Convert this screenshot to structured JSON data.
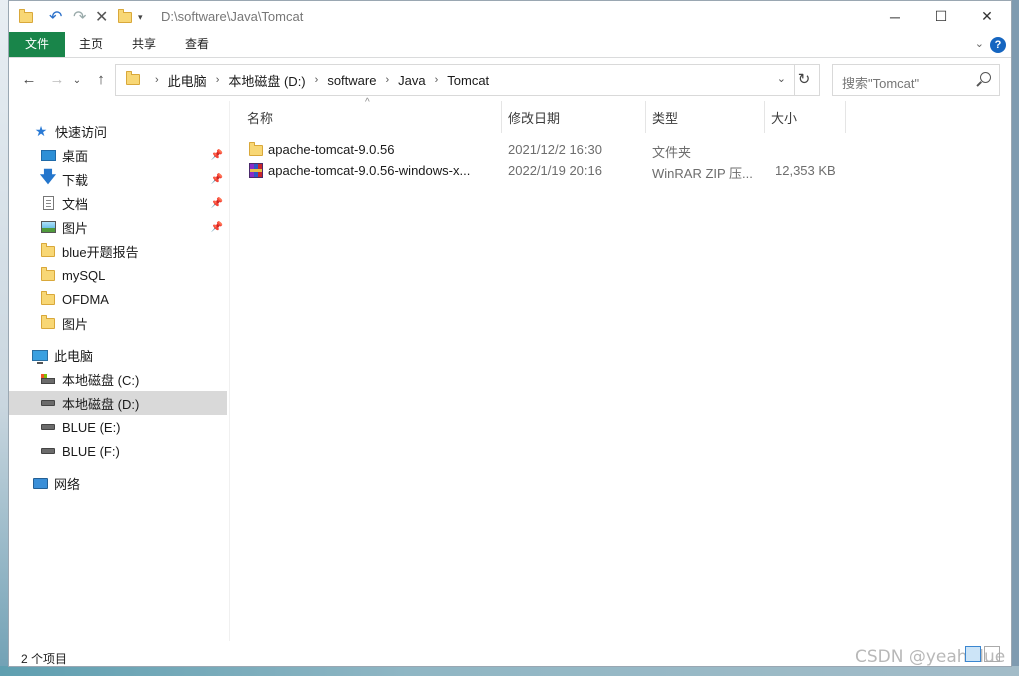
{
  "title_bar": {
    "path": "D:\\software\\Java\\Tomcat",
    "controls": {
      "minimize": "─",
      "maximize": "☐",
      "close": "✕"
    }
  },
  "ribbon": {
    "tabs": [
      "文件",
      "主页",
      "共享",
      "查看"
    ],
    "help": "?"
  },
  "address": {
    "crumbs": [
      "此电脑",
      "本地磁盘 (D:)",
      "software",
      "Java",
      "Tomcat"
    ],
    "search_placeholder": "搜索\"Tomcat\""
  },
  "nav_pane": {
    "quick_access": {
      "label": "快速访问",
      "icon": "star-icon"
    },
    "pinned": [
      {
        "label": "桌面",
        "icon": "desktop-icon"
      },
      {
        "label": "下载",
        "icon": "download-icon"
      },
      {
        "label": "文档",
        "icon": "document-icon"
      },
      {
        "label": "图片",
        "icon": "pictures-icon"
      }
    ],
    "folders": [
      "blue开题报告",
      "mySQL",
      "OFDMA",
      "图片"
    ],
    "this_pc": {
      "label": "此电脑",
      "icon": "computer-icon"
    },
    "drives": [
      {
        "label": "本地磁盘 (C:)",
        "selected": false
      },
      {
        "label": "本地磁盘 (D:)",
        "selected": true
      },
      {
        "label": "BLUE (E:)",
        "selected": false
      },
      {
        "label": "BLUE (F:)",
        "selected": false
      }
    ],
    "network": {
      "label": "网络",
      "icon": "network-icon"
    }
  },
  "columns": {
    "name": "名称",
    "modified": "修改日期",
    "type": "类型",
    "size": "大小"
  },
  "files": [
    {
      "name": "apache-tomcat-9.0.56",
      "modified": "2021/12/2 16:30",
      "type": "文件夹",
      "size": "",
      "icon": "folder-icon"
    },
    {
      "name": "apache-tomcat-9.0.56-windows-x...",
      "modified": "2022/1/19 20:16",
      "type": "WinRAR ZIP 压...",
      "size": "12,353 KB",
      "icon": "winrar-archive-icon"
    }
  ],
  "status": {
    "item_count": "2 个项目"
  },
  "watermark": "CSDN @yeahBlue",
  "colors": {
    "file_tab": "#19854a",
    "selection": "#d9d9d9",
    "accent": "#2a7ad5"
  }
}
